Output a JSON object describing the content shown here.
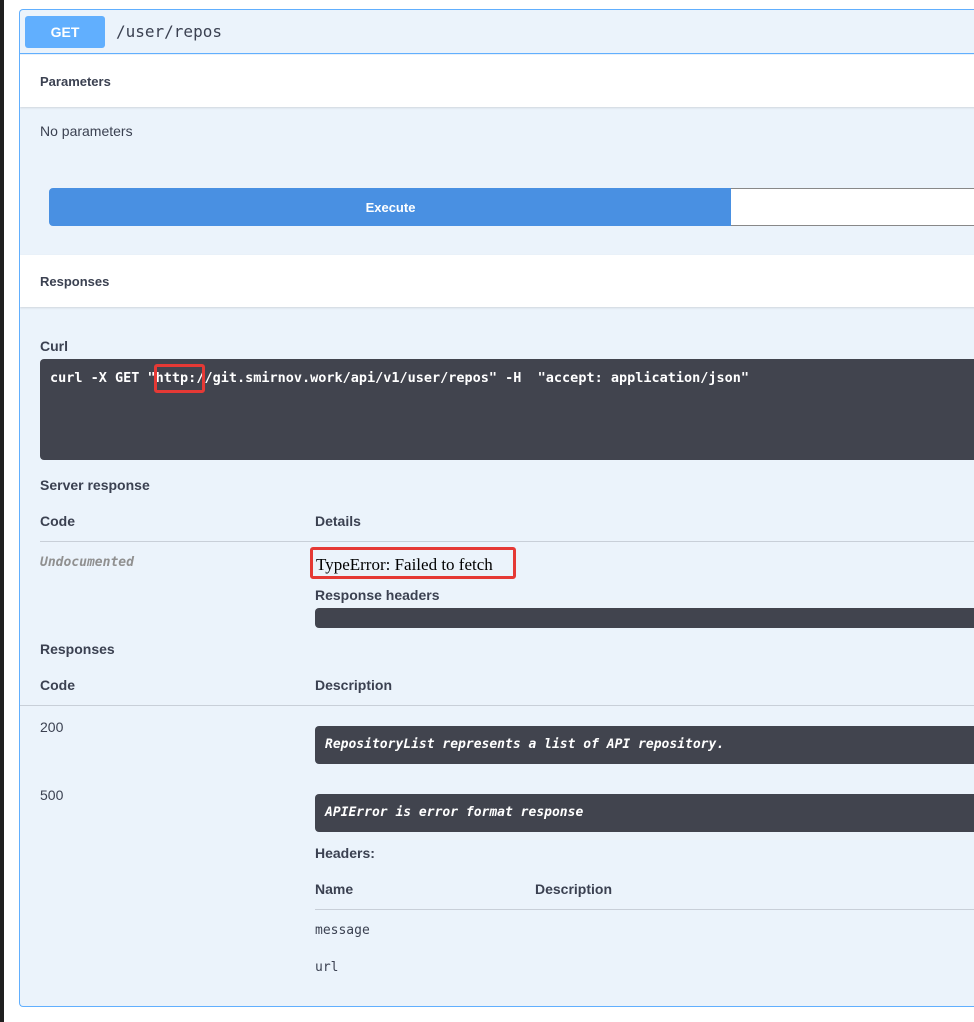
{
  "endpoint": {
    "method": "GET",
    "path": "/user/repos"
  },
  "parameters": {
    "title": "Parameters",
    "empty_text": "No parameters"
  },
  "execute": {
    "label": "Execute"
  },
  "responses_section": {
    "title": "Responses"
  },
  "curl": {
    "label": "Curl",
    "prefix": "curl -X GET \"",
    "highlight": "http:",
    "suffix": "//git.smirnov.work/api/v1/user/repos\" -H  \"accept: application/json\""
  },
  "server_response": {
    "title": "Server response",
    "code_header": "Code",
    "details_header": "Details",
    "code": "Undocumented",
    "error": "TypeError: Failed to fetch",
    "headers_label": "Response headers"
  },
  "responses": {
    "title": "Responses",
    "code_header": "Code",
    "description_header": "Description",
    "items": [
      {
        "code": "200",
        "description": "RepositoryList represents a list of API repository."
      },
      {
        "code": "500",
        "description": "APIError is error format response"
      }
    ],
    "headers_label": "Headers:",
    "headers_table": {
      "name_header": "Name",
      "description_header": "Description",
      "rows": [
        "message",
        "url"
      ]
    }
  },
  "colors": {
    "get_blue": "#61affe",
    "execute_blue": "#4990e2",
    "dark_panel": "#41444e",
    "highlight_red": "#e53935"
  }
}
